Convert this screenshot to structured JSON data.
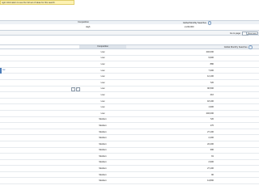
{
  "banner": {
    "text": "ngin information to see the full set of ideas for this search"
  },
  "summary": {
    "header_competition": "Competition",
    "header_gms": "Global Monthly Searches",
    "competition": "High",
    "gms": "2,240,000"
  },
  "controls": {
    "goto_label": "Go to page:",
    "show_rows_label": "Show rows:"
  },
  "table": {
    "header_competition": "Competition",
    "header_gms": "Global Monthly Searches",
    "rows": [
      {
        "kw": "",
        "comp": "Low",
        "gms": "246,000"
      },
      {
        "kw": "",
        "comp": "Low",
        "gms": "9,900"
      },
      {
        "kw": "",
        "comp": "Low",
        "gms": "880"
      },
      {
        "kw": "ow",
        "comp": "Low",
        "gms": "7,300"
      },
      {
        "kw": "",
        "comp": "Low",
        "gms": "12,100"
      },
      {
        "kw": "",
        "comp": "Low",
        "gms": "720"
      },
      {
        "kw": "",
        "comp": "Low",
        "gms": "90,500"
      },
      {
        "kw": "",
        "comp": "Low",
        "gms": "210"
      },
      {
        "kw": "",
        "comp": "Low",
        "gms": "18,100"
      },
      {
        "kw": "",
        "comp": "Low",
        "gms": "1,900"
      },
      {
        "kw": "",
        "comp": "Low",
        "gms": "246,000"
      },
      {
        "kw": "",
        "comp": "Medium",
        "gms": "720"
      },
      {
        "kw": "",
        "comp": "Medium",
        "gms": "170"
      },
      {
        "kw": "",
        "comp": "Medium",
        "gms": "27,100"
      },
      {
        "kw": "",
        "comp": "Medium",
        "gms": "2,400"
      },
      {
        "kw": "",
        "comp": "Medium",
        "gms": "22,200"
      },
      {
        "kw": "",
        "comp": "Medium",
        "gms": "390"
      },
      {
        "kw": "",
        "comp": "Medium",
        "gms": "91"
      },
      {
        "kw": "",
        "comp": "Medium",
        "gms": "2,900"
      },
      {
        "kw": "",
        "comp": "Medium",
        "gms": "27,100"
      },
      {
        "kw": "",
        "comp": "Medium",
        "gms": "90"
      },
      {
        "kw": "",
        "comp": "Medium",
        "gms": "14,800"
      }
    ]
  }
}
